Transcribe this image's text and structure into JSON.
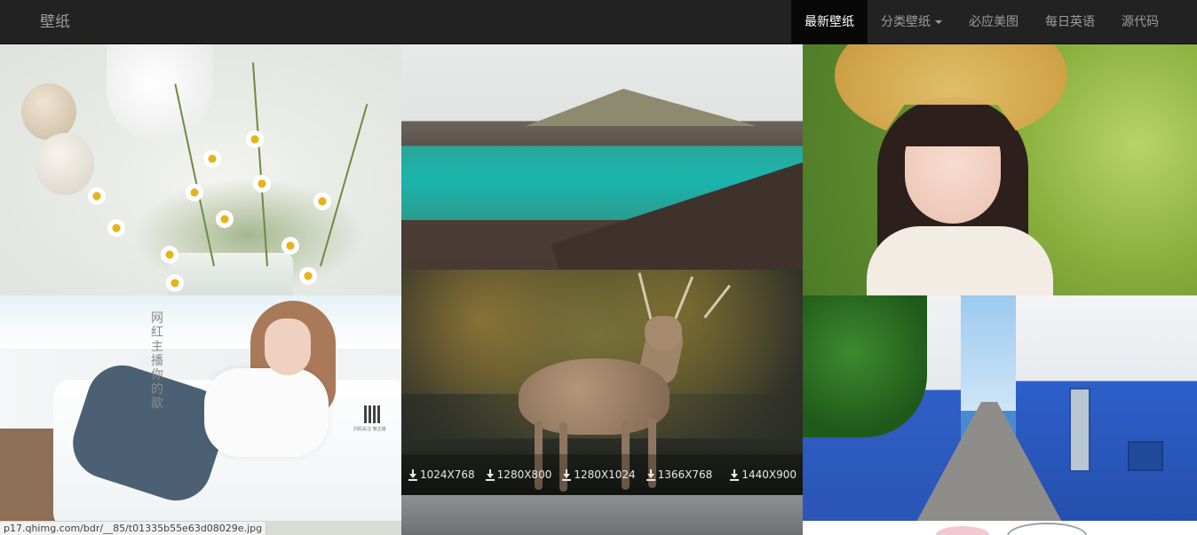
{
  "navbar": {
    "brand": "壁纸",
    "items": [
      {
        "label": "最新壁纸",
        "active": true
      },
      {
        "label": "分类壁纸",
        "dropdown": true
      },
      {
        "label": "必应美图"
      },
      {
        "label": "每日英语"
      },
      {
        "label": "源代码"
      }
    ]
  },
  "tiles": {
    "model": {
      "vertical_text": "网红主播 你的歆",
      "qr_caption": "扫码关注 微主播"
    },
    "deer": {
      "downloads": [
        "1024X768",
        "1280X800",
        "1280X1024",
        "1366X768",
        "1440X900"
      ]
    }
  },
  "status_bar": {
    "url": "p17.qhimg.com/bdr/__85/t01335b55e63d08029e.jpg"
  },
  "colors": {
    "navbar_bg": "#222222",
    "navbar_text": "#9d9d9d",
    "active_bg": "#080808"
  }
}
